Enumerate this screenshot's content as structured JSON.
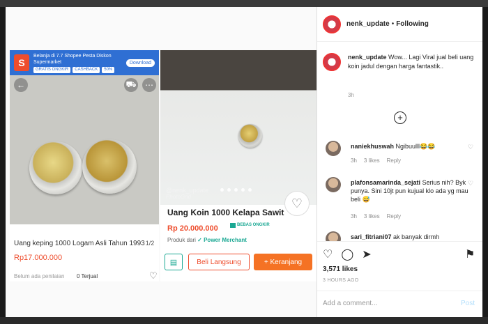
{
  "post": {
    "username": "nenk_update",
    "separator": "•",
    "follow_status": "Following",
    "caption": "Wow... Lagi Viral jual beli uang koin jadul dengan harga fantastik..",
    "caption_time": "3h",
    "load_more_icon": "plus-circle-icon",
    "likes": "3,571 likes",
    "posted_ago": "3 HOURS AGO",
    "add_comment_placeholder": "Add a comment...",
    "post_label": "Post"
  },
  "comments": [
    {
      "user": "naniekhuswah",
      "text": "Ngibuulll😂😂",
      "time": "3h",
      "likes": "3 likes",
      "reply": "Reply"
    },
    {
      "user": "plafonsamarinda_sejati",
      "text": "Serius nih? Byk punya. Sini 10jt pun kujual klo ada yg mau beli 😅",
      "time": "3h",
      "likes": "3 likes",
      "reply": "Reply"
    },
    {
      "user": "sari_fitriani07",
      "text": "ak banyak dirmh",
      "time": "",
      "likes": "",
      "reply": ""
    }
  ],
  "product_left": {
    "banner_text": "Belanja di 7.7 Shopee Pesta Diskon Supermarket",
    "banner_pill_1": "GRATIS ONGKIR",
    "banner_pill_2": "CASHBACK",
    "banner_pill_3": "50%",
    "banner_button": "Download",
    "pager": "1/2",
    "title": "Uang keping 1000 Logam Asli Tahun 1993",
    "price": "Rp17.000.000",
    "rating": "Belum ada penilaian",
    "sold": "0 Terjual"
  },
  "product_right": {
    "watermark_user": "@nenk_update",
    "watermark_app": "PhotoGrid",
    "title": "Uang Koin 1000 Kelapa Sawit",
    "price": "Rp 20.000.000",
    "free_shipping": "BEBAS ONGKIR",
    "seller_prefix": "Produk dari",
    "merchant": "Power Merchant",
    "buy_now": "Beli Langsung",
    "add_cart": "+ Keranjang"
  }
}
